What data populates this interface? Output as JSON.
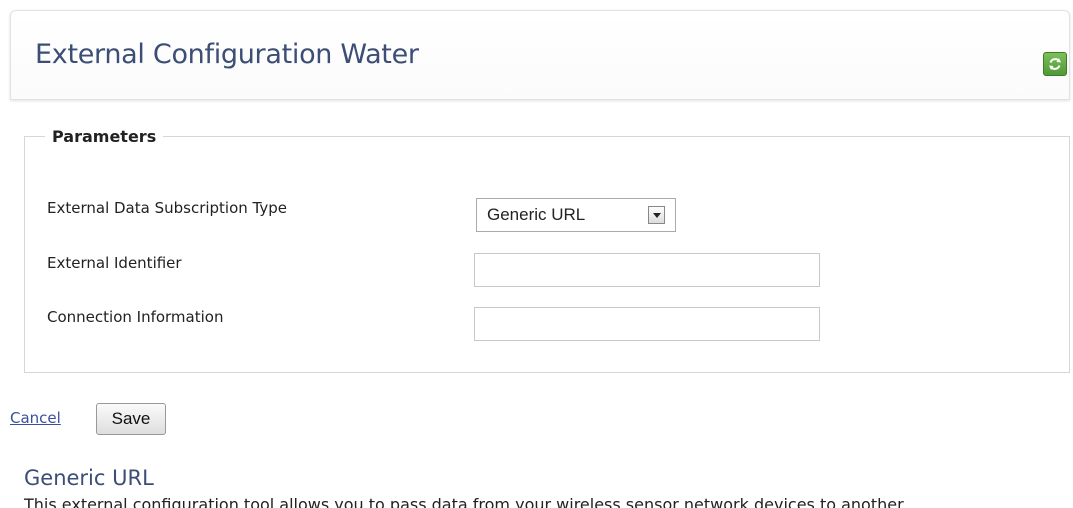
{
  "header": {
    "title": "External Configuration Water",
    "refresh_icon": "refresh-icon"
  },
  "parameters": {
    "legend": "Parameters",
    "subscription_type_label": "External Data Subscription Type",
    "subscription_type_value": "Generic URL",
    "identifier_label": "External Identifier",
    "identifier_value": "",
    "connection_label": "Connection Information",
    "connection_value": ""
  },
  "actions": {
    "cancel_label": "Cancel",
    "save_label": "Save"
  },
  "info": {
    "title": "Generic URL",
    "description": "This external configuration tool allows you to pass data from your wireless sensor network devices to another"
  },
  "colors": {
    "title": "#3c4e75",
    "link": "#3a4fa0",
    "refresh_green": "#4e9a36"
  }
}
